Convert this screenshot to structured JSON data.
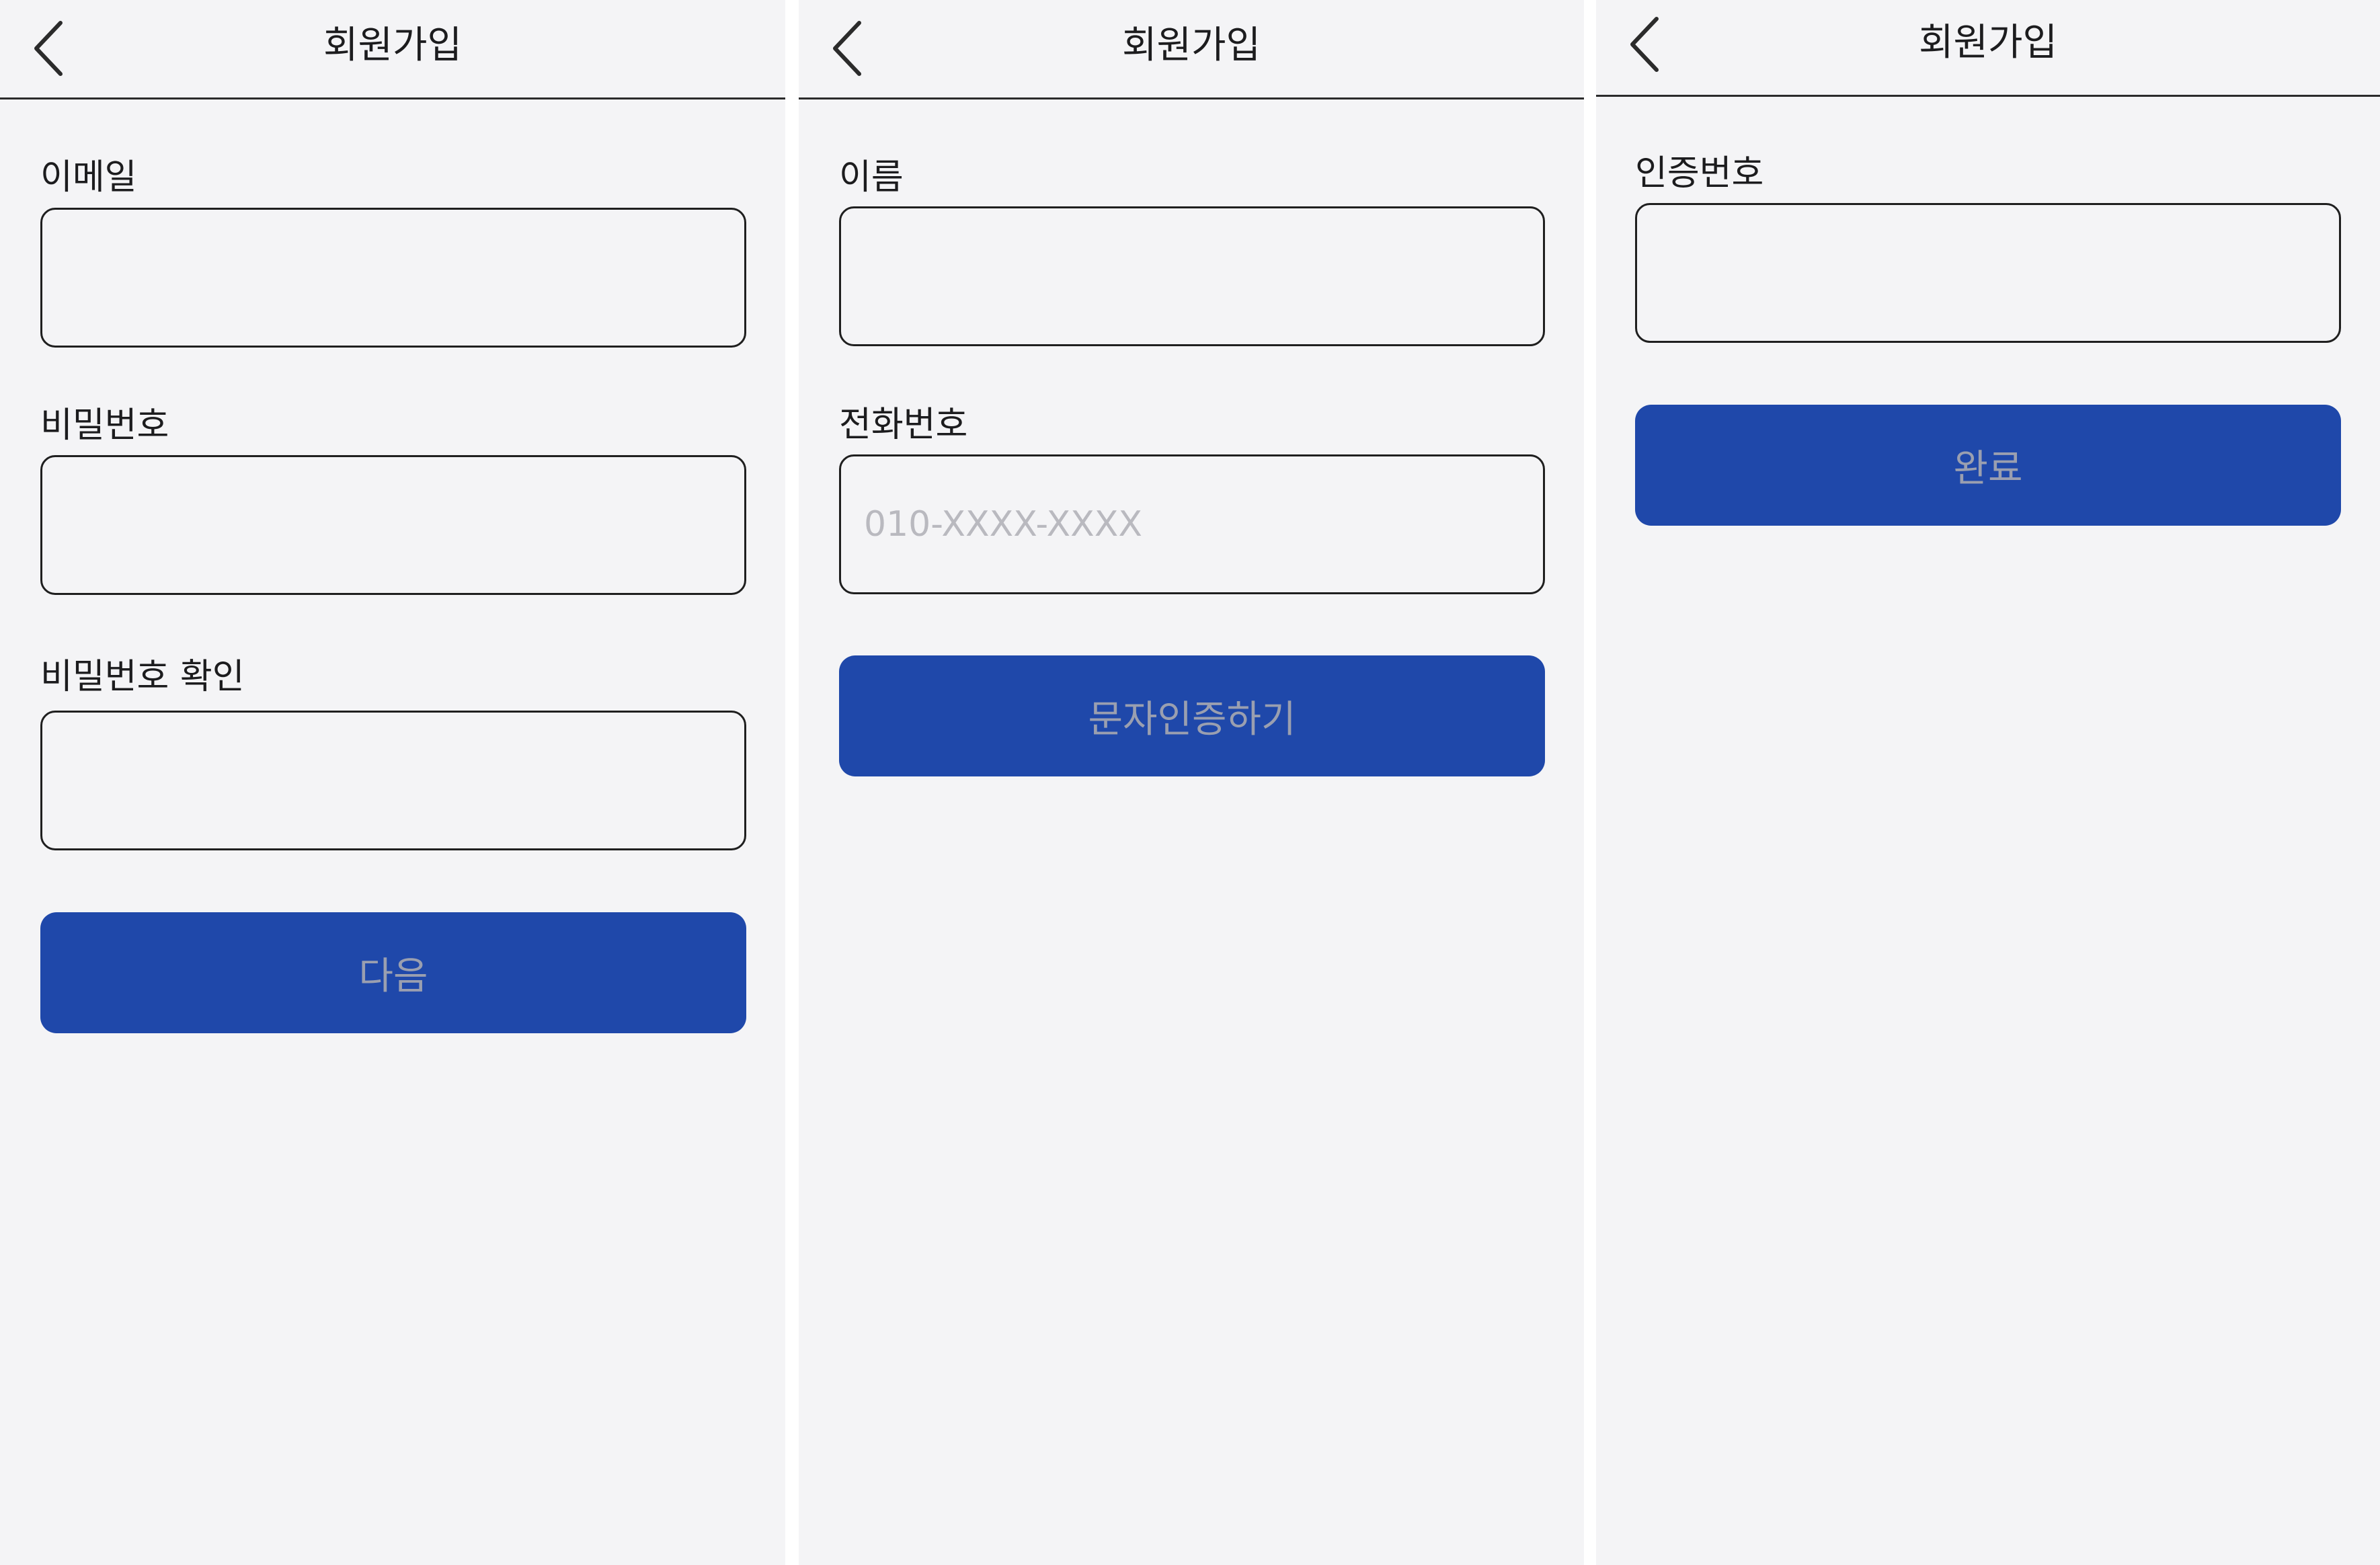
{
  "screens": [
    {
      "title": "회원가입",
      "fields": [
        {
          "label": "이메일",
          "value": "",
          "placeholder": ""
        },
        {
          "label": "비밀번호",
          "value": "",
          "placeholder": ""
        },
        {
          "label": "비밀번호 확인",
          "value": "",
          "placeholder": ""
        }
      ],
      "button_label": "다음"
    },
    {
      "title": "회원가입",
      "fields": [
        {
          "label": "이름",
          "value": "",
          "placeholder": ""
        },
        {
          "label": "전화번호",
          "value": "",
          "placeholder": "010-XXXX-XXXX"
        }
      ],
      "button_label": "문자인증하기"
    },
    {
      "title": "회원가입",
      "fields": [
        {
          "label": "인증번호",
          "value": "",
          "placeholder": ""
        }
      ],
      "button_label": "완료"
    }
  ],
  "icons": {
    "back": "chevron-left-icon"
  },
  "colors": {
    "primary": "#1f48aa",
    "background": "#f4f4f6",
    "button_text": "#9a9fb0",
    "placeholder": "#b9b9bf"
  }
}
